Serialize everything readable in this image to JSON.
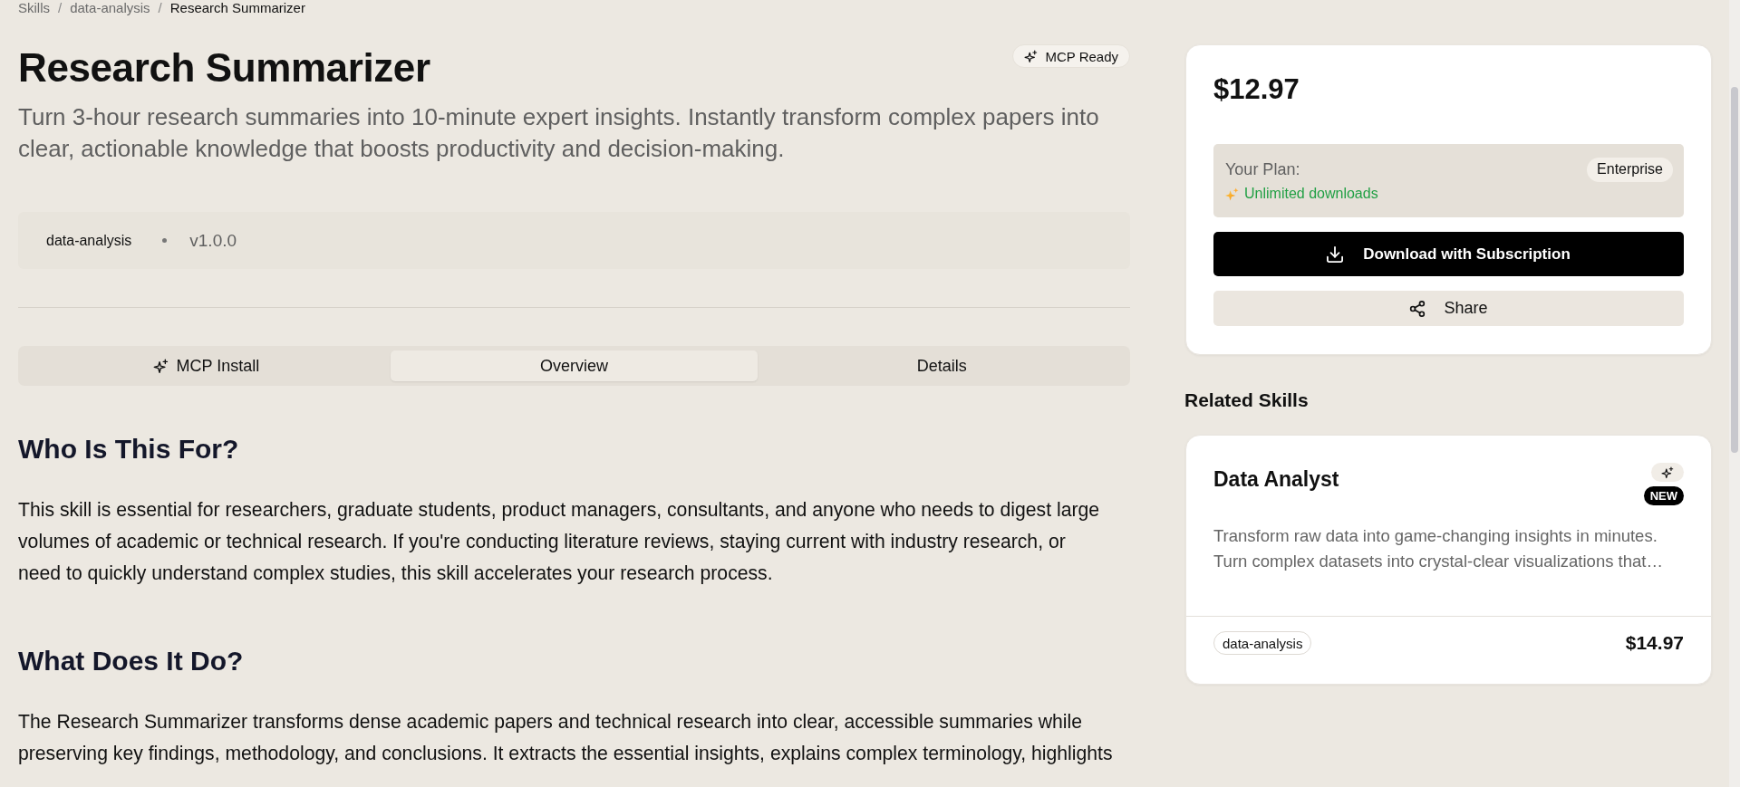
{
  "breadcrumb": {
    "items": [
      {
        "label": "Skills",
        "current": false
      },
      {
        "label": "data-analysis",
        "current": false
      },
      {
        "label": "Research Summarizer",
        "current": true
      }
    ],
    "separators": [
      "/",
      "/"
    ]
  },
  "header": {
    "title": "Research Summarizer",
    "badge": {
      "label": "MCP Ready"
    },
    "subtitle": "Turn 3-hour research summaries into 10-minute expert insights. Instantly transform complex papers into clear, actionable knowledge that boosts productivity and decision-making."
  },
  "meta": {
    "tag": "data-analysis",
    "version": "v1.0.0"
  },
  "tabs": [
    {
      "label": "MCP Install",
      "kind": "mcp",
      "selected": false
    },
    {
      "label": "Overview",
      "kind": "plain",
      "selected": true
    },
    {
      "label": "Details",
      "kind": "plain",
      "selected": false
    }
  ],
  "sections": [
    {
      "heading": "Who Is This For?",
      "body": "This skill is essential for researchers, graduate students, product managers, consultants, and anyone who needs to digest large volumes of academic or technical research. If you're conducting literature reviews, staying current with industry research, or need to quickly understand complex studies, this skill accelerates your research process."
    },
    {
      "heading": "What Does It Do?",
      "body": "The Research Summarizer transforms dense academic papers and technical research into clear, accessible summaries while preserving key findings, methodology, and conclusions. It extracts the essential insights, explains complex terminology, highlights"
    }
  ],
  "purchase": {
    "price": "$12.97",
    "plan_label": "Your Plan:",
    "plan": "Enterprise",
    "plan_note": "Unlimited downloads",
    "buttons": [
      {
        "label": "Download with Subscription",
        "kind": "primary"
      },
      {
        "label": "Share",
        "kind": "secondary"
      }
    ]
  },
  "related": {
    "title": "Related Skills",
    "cards": [
      {
        "name": "Data Analyst",
        "mcp": true,
        "badge": "NEW",
        "description": "Transform raw data into game-changing insights in minutes. Turn complex datasets into crystal-clear visualizations that…",
        "tag": "data-analysis",
        "price": "$14.97"
      }
    ]
  }
}
